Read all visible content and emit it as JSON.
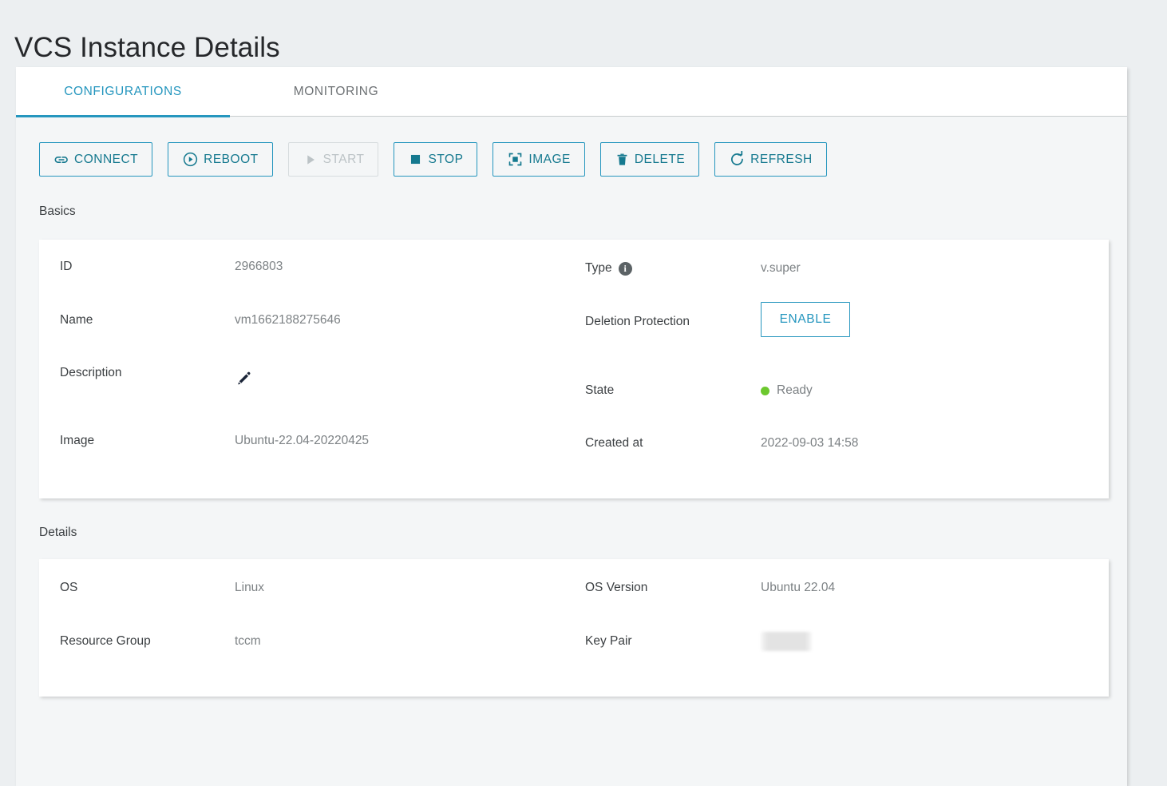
{
  "page": {
    "title": "VCS Instance Details"
  },
  "tabs": [
    {
      "id": "configurations",
      "label": "CONFIGURATIONS",
      "active": true
    },
    {
      "id": "monitoring",
      "label": "MONITORING",
      "active": false
    }
  ],
  "toolbar": {
    "buttons": [
      {
        "id": "connect",
        "label": "CONNECT",
        "icon": "link-icon",
        "disabled": false
      },
      {
        "id": "reboot",
        "label": "REBOOT",
        "icon": "reboot-play-circle-icon",
        "disabled": false
      },
      {
        "id": "start",
        "label": "START",
        "icon": "play-triangle-icon",
        "disabled": true
      },
      {
        "id": "stop",
        "label": "STOP",
        "icon": "stop-square-icon",
        "disabled": false
      },
      {
        "id": "image",
        "label": "IMAGE",
        "icon": "image-snapshot-icon",
        "disabled": false
      },
      {
        "id": "delete",
        "label": "DELETE",
        "icon": "trash-icon",
        "disabled": false
      },
      {
        "id": "refresh",
        "label": "REFRESH",
        "icon": "refresh-icon",
        "disabled": false
      }
    ]
  },
  "sections": {
    "basics": {
      "heading": "Basics",
      "left": [
        {
          "label": "ID",
          "value": "2966803"
        },
        {
          "label": "Name",
          "value": "vm1662188275646"
        },
        {
          "label": "Description",
          "value": ""
        },
        {
          "label": "Image",
          "value": "Ubuntu-22.04-20220425"
        }
      ],
      "right": [
        {
          "label": "Type",
          "value": "v.super"
        },
        {
          "label": "Deletion Protection",
          "value": ""
        },
        {
          "label": "State",
          "value": "Ready"
        },
        {
          "label": "Created at",
          "value": "2022-09-03 14:58"
        }
      ],
      "type_info_icon": "info-icon",
      "description_edit_icon": "edit-pencil-icon",
      "deletion_protection_button": "ENABLE",
      "state_dot_color": "#6cc82e"
    },
    "details": {
      "heading": "Details",
      "left": [
        {
          "label": "OS",
          "value": "Linux"
        },
        {
          "label": "Resource Group",
          "value": "tccm"
        }
      ],
      "right": [
        {
          "label": "OS Version",
          "value": "Ubuntu 22.04"
        },
        {
          "label": "Key Pair",
          "value": ""
        }
      ],
      "key_pair_redacted": true
    }
  },
  "colors": {
    "accent": "#2596be",
    "accent_text": "#15798f",
    "page_background": "#eceff1",
    "panel_background": "#f4f6f7",
    "card_background": "#ffffff",
    "label_text": "#3b3f42",
    "value_text": "#7c8184",
    "disabled": "#bcc3c6",
    "status_ready": "#6cc82e"
  }
}
